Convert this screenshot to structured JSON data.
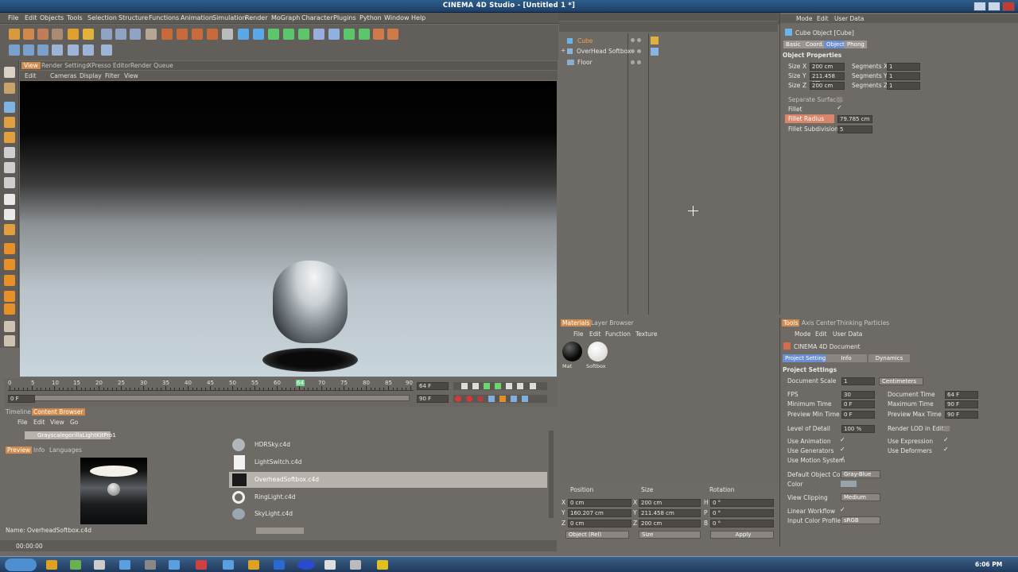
{
  "window": {
    "title": "CINEMA 4D Studio - [Untitled 1 *]"
  },
  "menubar": [
    "File",
    "Edit",
    "Objects",
    "Tools",
    "Selection",
    "Structure",
    "Functions",
    "Animation",
    "Simulation",
    "Render",
    "MoGraph",
    "Character",
    "Plugins",
    "Python",
    "Window",
    "Help"
  ],
  "viewport": {
    "tabs": [
      "View",
      "Render Settings",
      "XPresso Editor",
      "Render Queue"
    ],
    "menu": [
      "Edit",
      "Cameras",
      "Display",
      "Filter",
      "View"
    ]
  },
  "timeline": {
    "ticks": [
      "0",
      "5",
      "10",
      "15",
      "20",
      "25",
      "30",
      "35",
      "40",
      "45",
      "50",
      "55",
      "60",
      "65",
      "70",
      "75",
      "80",
      "85",
      "90"
    ],
    "current_frame": "64",
    "frame_display": "64 F",
    "start_field": "0 F",
    "end_field": "90 F",
    "range_start": "0 F",
    "range_end": "90 F"
  },
  "object_manager": {
    "objects": [
      {
        "name": "Cube",
        "selected": true
      },
      {
        "name": "OverHead Softbox"
      },
      {
        "name": "Floor"
      }
    ]
  },
  "attributes": {
    "menu": [
      "Mode",
      "Edit",
      "User Data"
    ],
    "object_title": "Cube Object [Cube]",
    "tabs": [
      "Basic",
      "Coord.",
      "Object",
      "Phong"
    ],
    "active_tab": "Object",
    "section": "Object Properties",
    "size": [
      {
        "axis": "X",
        "value": "200 cm"
      },
      {
        "axis": "Y",
        "value": "211.458 cm"
      },
      {
        "axis": "Z",
        "value": "200 cm"
      }
    ],
    "segments": [
      {
        "label": "Segments X",
        "value": "1"
      },
      {
        "label": "Segments Y",
        "value": "1"
      },
      {
        "label": "Segments Z",
        "value": "1"
      }
    ],
    "size_label": "Size",
    "separate_surfaces": "Separate Surfaces",
    "fillet": "Fillet",
    "fillet_radius_label": "Fillet Radius",
    "fillet_radius": "79.785 cm",
    "fillet_subdivision_label": "Fillet Subdivision",
    "fillet_subdivision": "5"
  },
  "materials": {
    "tabs": [
      "Materials",
      "Layer Browser"
    ],
    "menu": [
      "File",
      "Edit",
      "Function",
      "Texture"
    ],
    "items": [
      "Mat",
      "Softbox"
    ]
  },
  "coordinates": {
    "headers": [
      "Position",
      "Size",
      "Rotation"
    ],
    "rows": [
      {
        "axis": "X",
        "pos": "0 cm",
        "size": "200 cm",
        "rlabel": "H",
        "rot": "0 °"
      },
      {
        "axis": "Y",
        "pos": "160.207 cm",
        "size": "211.458 cm",
        "rlabel": "P",
        "rot": "0 °"
      },
      {
        "axis": "Z",
        "pos": "0 cm",
        "size": "200 cm",
        "rlabel": "B",
        "rot": "0 °"
      }
    ],
    "mode": "Object (Rel)",
    "size_mode": "Size",
    "apply": "Apply"
  },
  "tools_panel": {
    "tabs": [
      "Tools",
      "Axis Center",
      "Thinking Particles"
    ],
    "menu": [
      "Mode",
      "Edit",
      "User Data"
    ],
    "doc_title": "CINEMA 4D Document",
    "subtabs": [
      "Project Settings",
      "Info",
      "Dynamics"
    ],
    "section": "Project Settings",
    "document_scale_label": "Document Scale",
    "document_scale": "1",
    "units": "Centimeters",
    "fps_label": "FPS",
    "fps": "30",
    "doc_time_label": "Document Time",
    "doc_time": "64 F",
    "min_time_label": "Minimum Time",
    "min_time": "0 F",
    "max_time_label": "Maximum Time",
    "max_time": "90 F",
    "prev_min_label": "Preview Min Time",
    "prev_min": "0 F",
    "prev_max_label": "Preview Max Time",
    "prev_max": "90 F",
    "lod_label": "Level of Detail",
    "lod": "100 %",
    "render_lod": "Render LOD in Editor",
    "use_animation": "Use Animation",
    "use_expression": "Use Expression",
    "use_generators": "Use Generators",
    "use_deformers": "Use Deformers",
    "use_motion": "Use Motion System",
    "default_color_label": "Default Object Color",
    "default_color": "Gray-Blue",
    "color_label": "Color",
    "view_clipping_label": "View Clipping",
    "view_clipping": "Medium",
    "linear_workflow": "Linear Workflow",
    "input_color_label": "Input Color Profile",
    "input_color": "sRGB"
  },
  "content_browser": {
    "tabs": [
      "Timeline",
      "Content Browser"
    ],
    "menu": [
      "File",
      "Edit",
      "View",
      "Go"
    ],
    "path": "GrayscalegorillaLightKitPro1",
    "preview_tabs": [
      "Preview",
      "Info",
      "Languages"
    ],
    "files": [
      "HDRSky.c4d",
      "LightSwitch.c4d",
      "OverheadSoftbox.c4d",
      "RingLight.c4d",
      "SkyLight.c4d"
    ],
    "selected_file": "OverheadSoftbox.c4d",
    "name_label": "Name: OverheadSoftbox.c4d"
  },
  "status": {
    "time": "00:00:00"
  },
  "taskbar": {
    "clock": "6:06 PM"
  },
  "colors": {
    "accent": "#e59a3a",
    "highlight": "#d9856a",
    "selected_row": "#b8b2ad"
  }
}
